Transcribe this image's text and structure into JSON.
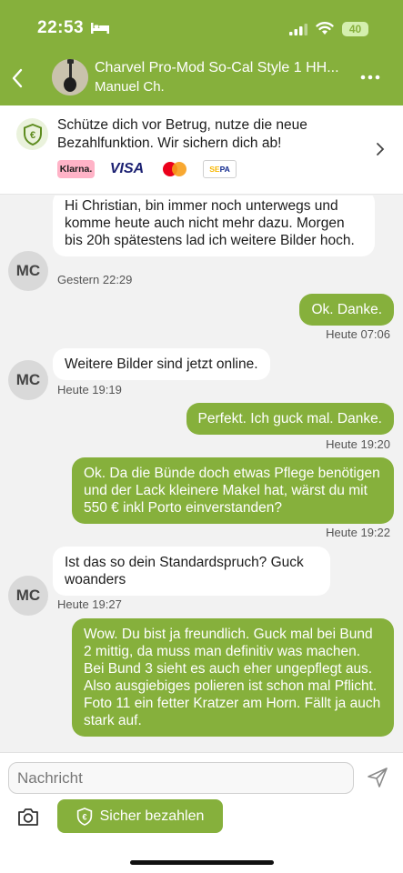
{
  "status_bar": {
    "time": "22:53",
    "battery": "40"
  },
  "header": {
    "title": "Charvel Pro-Mod So-Cal Style 1 HH...",
    "subtitle": "Manuel Ch."
  },
  "banner": {
    "text": "Schütze dich vor Betrug, nutze die neue Bezahlfunktion. Wir sichern dich ab!",
    "logos": {
      "klarna": "Klarna.",
      "visa": "VISA",
      "sepa_se": "SE",
      "sepa_pa": "PA"
    }
  },
  "avatar_initials": "MC",
  "messages": [
    {
      "dir": "in",
      "text": "Hi Christian, bin immer noch unterwegs und komme heute auch nicht mehr dazu. Morgen bis 20h spätestens lad ich weitere Bilder hoch.",
      "time": "Gestern 22:29"
    },
    {
      "dir": "out",
      "text": "Ok. Danke.",
      "time": "Heute 07:06"
    },
    {
      "dir": "in",
      "text": "Weitere Bilder sind jetzt online.",
      "time": "Heute 19:19"
    },
    {
      "dir": "out",
      "text": "Perfekt. Ich guck mal. Danke.",
      "time": "Heute 19:20"
    },
    {
      "dir": "out",
      "text": "Ok. Da die Bünde doch etwas Pflege benötigen und der Lack kleinere Makel hat, wärst du mit 550 € inkl Porto einverstanden?",
      "time": "Heute 19:22"
    },
    {
      "dir": "in",
      "text": "Ist das so dein Standardspruch? Guck woanders",
      "time": "Heute 19:27"
    },
    {
      "dir": "out",
      "text": "Wow. Du bist ja freundlich. Guck mal bei Bund 2 mittig, da muss man definitiv was machen. Bei Bund 3 sieht es auch eher ungepflegt aus. Also ausgiebiges polieren ist schon mal Pflicht.\nFoto 11 ein fetter Kratzer am Horn. Fällt ja auch stark auf.",
      "time": ""
    }
  ],
  "composer": {
    "placeholder": "Nachricht",
    "pay_button": "Sicher bezahlen"
  },
  "colors": {
    "brand": "#86b03c",
    "bubble_in": "#ffffff",
    "background": "#f2f2f2"
  }
}
